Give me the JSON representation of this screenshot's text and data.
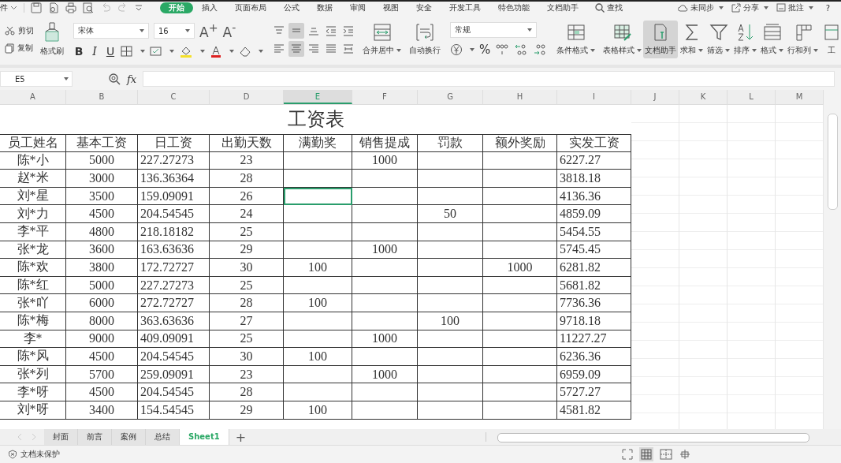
{
  "menu": {
    "file_label": "件",
    "tabs": [
      {
        "label": "开始",
        "selected": true
      },
      {
        "label": "插入",
        "selected": false
      },
      {
        "label": "页面布局",
        "selected": false
      },
      {
        "label": "公式",
        "selected": false
      },
      {
        "label": "数据",
        "selected": false
      },
      {
        "label": "审阅",
        "selected": false
      },
      {
        "label": "视图",
        "selected": false
      },
      {
        "label": "安全",
        "selected": false
      },
      {
        "label": "开发工具",
        "selected": false
      },
      {
        "label": "特色功能",
        "selected": false
      },
      {
        "label": "文档助手",
        "selected": false
      }
    ],
    "search": "查找",
    "right": [
      {
        "label": "未同步"
      },
      {
        "label": "分享"
      },
      {
        "label": "批注"
      }
    ],
    "help": "?"
  },
  "ribbon": {
    "clipboard": [
      {
        "label": "剪切"
      },
      {
        "label": "复制"
      }
    ],
    "format_painter": {
      "label": "格式刷"
    },
    "font": {
      "name": "宋体",
      "size": "16",
      "grow": "A$^{+}$",
      "shrink": "A$^{-}$",
      "styles": [
        "B",
        "I",
        "U"
      ]
    },
    "vertical_align": [
      {
        "selected": false
      },
      {
        "selected": true
      },
      {
        "selected": false
      },
      {
        "selected": false
      },
      {
        "selected": false
      }
    ],
    "horizontal_align": [
      {
        "selected": false
      },
      {
        "selected": true
      },
      {
        "selected": false
      },
      {
        "selected": false
      },
      {
        "selected": false
      }
    ],
    "align_buttons": [
      {
        "label": "合并居中",
        "dropdown": true
      },
      {
        "label": "自动换行",
        "dropdown": false
      }
    ],
    "number": {
      "format": "常规",
      "percent": "%"
    },
    "style_buttons": [
      {
        "label": "条件格式",
        "dropdown": true
      },
      {
        "label": "表格样式",
        "dropdown": true
      }
    ],
    "tool_buttons": [
      {
        "label": "文档助手",
        "dropdown": false,
        "active": true
      },
      {
        "label": "求和",
        "dropdown": true,
        "active": false
      },
      {
        "label": "筛选",
        "dropdown": true,
        "active": false
      },
      {
        "label": "排序",
        "dropdown": true,
        "active": false
      },
      {
        "label": "格式",
        "dropdown": true,
        "active": false
      },
      {
        "label": "行和列",
        "dropdown": true,
        "active": false
      },
      {
        "label": "工",
        "dropdown": false,
        "active": false
      }
    ]
  },
  "formula_bar": {
    "cell_ref": "E5",
    "fx": "fx"
  },
  "sheet": {
    "columns": [
      {
        "label": "A",
        "selected": false
      },
      {
        "label": "B",
        "selected": false
      },
      {
        "label": "C",
        "selected": false
      },
      {
        "label": "D",
        "selected": false
      },
      {
        "label": "E",
        "selected": true
      },
      {
        "label": "F",
        "selected": false
      },
      {
        "label": "G",
        "selected": false
      },
      {
        "label": "H",
        "selected": false
      },
      {
        "label": "I",
        "selected": false
      },
      {
        "label": "J",
        "selected": false
      },
      {
        "label": "K",
        "selected": false
      },
      {
        "label": "L",
        "selected": false
      },
      {
        "label": "M",
        "selected": false
      }
    ],
    "title": "工资表",
    "headers": [
      "员工姓名",
      "基本工资",
      "日工资",
      "出勤天数",
      "满勤奖",
      "销售提成",
      "罚款",
      "额外奖励",
      "实发工资"
    ],
    "rows": [
      {
        "selected": false,
        "cells": [
          "陈*小",
          "5000",
          "227.27273",
          "23",
          null,
          "1000",
          null,
          null,
          "6227.27"
        ]
      },
      {
        "selected": false,
        "cells": [
          "赵*米",
          "3000",
          "136.36364",
          "28",
          null,
          null,
          null,
          null,
          "3818.18"
        ]
      },
      {
        "selected": true,
        "cells": [
          "刘*星",
          "3500",
          "159.09091",
          "26",
          null,
          null,
          null,
          null,
          "4136.36"
        ]
      },
      {
        "selected": false,
        "cells": [
          "刘*力",
          "4500",
          "204.54545",
          "24",
          null,
          null,
          "50",
          null,
          "4859.09"
        ]
      },
      {
        "selected": false,
        "cells": [
          "李*平",
          "4800",
          "218.18182",
          "25",
          null,
          null,
          null,
          null,
          "5454.55"
        ]
      },
      {
        "selected": false,
        "cells": [
          "张*龙",
          "3600",
          "163.63636",
          "29",
          null,
          "1000",
          null,
          null,
          "5745.45"
        ]
      },
      {
        "selected": false,
        "cells": [
          "陈*欢",
          "3800",
          "172.72727",
          "30",
          "100",
          null,
          null,
          "1000",
          "6281.82"
        ]
      },
      {
        "selected": false,
        "cells": [
          "陈*红",
          "5000",
          "227.27273",
          "25",
          null,
          null,
          null,
          null,
          "5681.82"
        ]
      },
      {
        "selected": false,
        "cells": [
          "张*吖",
          "6000",
          "272.72727",
          "28",
          "100",
          null,
          null,
          null,
          "7736.36"
        ]
      },
      {
        "selected": false,
        "cells": [
          "陈*梅",
          "8000",
          "363.63636",
          "27",
          null,
          null,
          "100",
          null,
          "9718.18"
        ]
      },
      {
        "selected": false,
        "cells": [
          "李*",
          "9000",
          "409.09091",
          "25",
          null,
          "1000",
          null,
          null,
          "11227.27"
        ]
      },
      {
        "selected": false,
        "cells": [
          "陈*风",
          "4500",
          "204.54545",
          "30",
          "100",
          null,
          null,
          null,
          "6236.36"
        ]
      },
      {
        "selected": false,
        "cells": [
          "张*列",
          "5700",
          "259.09091",
          "23",
          null,
          "1000",
          null,
          null,
          "6959.09"
        ]
      },
      {
        "selected": false,
        "cells": [
          "李*呀",
          "4500",
          "204.54545",
          "28",
          null,
          null,
          null,
          null,
          "5727.27"
        ]
      },
      {
        "selected": false,
        "cells": [
          "刘*呀",
          "3400",
          "154.54545",
          "29",
          "100",
          null,
          null,
          null,
          "4581.82"
        ]
      }
    ]
  },
  "sheet_tabs": {
    "tabs": [
      {
        "label": "封面",
        "selected": false
      },
      {
        "label": "前言",
        "selected": false
      },
      {
        "label": "案例",
        "selected": false
      },
      {
        "label": "总结",
        "selected": false
      },
      {
        "label": "Sheet1",
        "selected": true
      }
    ],
    "add": "+"
  },
  "status_bar": {
    "protection": "文档未保护"
  }
}
